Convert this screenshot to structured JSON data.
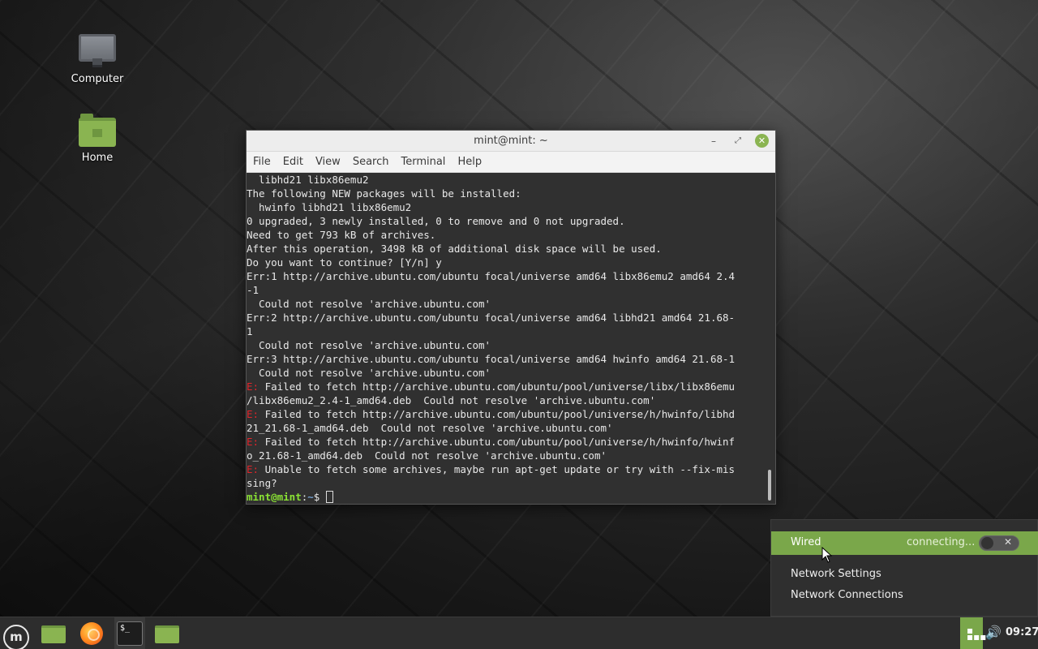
{
  "desktop": {
    "icons": [
      {
        "label": "Computer",
        "icon": "computer-icon"
      },
      {
        "label": "Home",
        "icon": "home-folder-icon"
      }
    ]
  },
  "terminal": {
    "title": "mint@mint: ~",
    "menu": [
      "File",
      "Edit",
      "View",
      "Search",
      "Terminal",
      "Help"
    ],
    "lines": [
      {
        "text": "  libhd21 libx86emu2"
      },
      {
        "text": "The following NEW packages will be installed:"
      },
      {
        "text": "  hwinfo libhd21 libx86emu2"
      },
      {
        "text": "0 upgraded, 3 newly installed, 0 to remove and 0 not upgraded."
      },
      {
        "text": "Need to get 793 kB of archives."
      },
      {
        "text": "After this operation, 3498 kB of additional disk space will be used."
      },
      {
        "text": "Do you want to continue? [Y/n] y"
      },
      {
        "text": "Err:1 http://archive.ubuntu.com/ubuntu focal/universe amd64 libx86emu2 amd64 2.4"
      },
      {
        "text": "-1"
      },
      {
        "text": "  Could not resolve 'archive.ubuntu.com'"
      },
      {
        "text": "Err:2 http://archive.ubuntu.com/ubuntu focal/universe amd64 libhd21 amd64 21.68-"
      },
      {
        "text": "1"
      },
      {
        "text": "  Could not resolve 'archive.ubuntu.com'"
      },
      {
        "text": "Err:3 http://archive.ubuntu.com/ubuntu focal/universe amd64 hwinfo amd64 21.68-1"
      },
      {
        "text": "  Could not resolve 'archive.ubuntu.com'"
      },
      {
        "err": "E:",
        "text": " Failed to fetch http://archive.ubuntu.com/ubuntu/pool/universe/libx/libx86emu"
      },
      {
        "text": "/libx86emu2_2.4-1_amd64.deb  Could not resolve 'archive.ubuntu.com'"
      },
      {
        "err": "E:",
        "text": " Failed to fetch http://archive.ubuntu.com/ubuntu/pool/universe/h/hwinfo/libhd"
      },
      {
        "text": "21_21.68-1_amd64.deb  Could not resolve 'archive.ubuntu.com'"
      },
      {
        "err": "E:",
        "text": " Failed to fetch http://archive.ubuntu.com/ubuntu/pool/universe/h/hwinfo/hwinf"
      },
      {
        "text": "o_21.68-1_amd64.deb  Could not resolve 'archive.ubuntu.com'"
      },
      {
        "err": "E:",
        "text": " Unable to fetch some archives, maybe run apt-get update or try with --fix-mis"
      },
      {
        "text": "sing?"
      }
    ],
    "prompt": {
      "user": "mint@mint",
      "sep": ":",
      "path": "~",
      "symbol": "$ "
    }
  },
  "network_menu": {
    "wired_label": "Wired",
    "wired_state": "connecting...",
    "toggle_on": false,
    "items": [
      "Network Settings",
      "Network Connections"
    ]
  },
  "panel": {
    "clock": "09:27",
    "launchers": [
      "menu-icon",
      "files-icon",
      "firefox-icon",
      "terminal-icon",
      "folder-icon"
    ]
  },
  "colors": {
    "accent": "#8ab451",
    "error": "#e0252a",
    "prompt_user": "#8ae234",
    "prompt_path": "#729fcf"
  }
}
